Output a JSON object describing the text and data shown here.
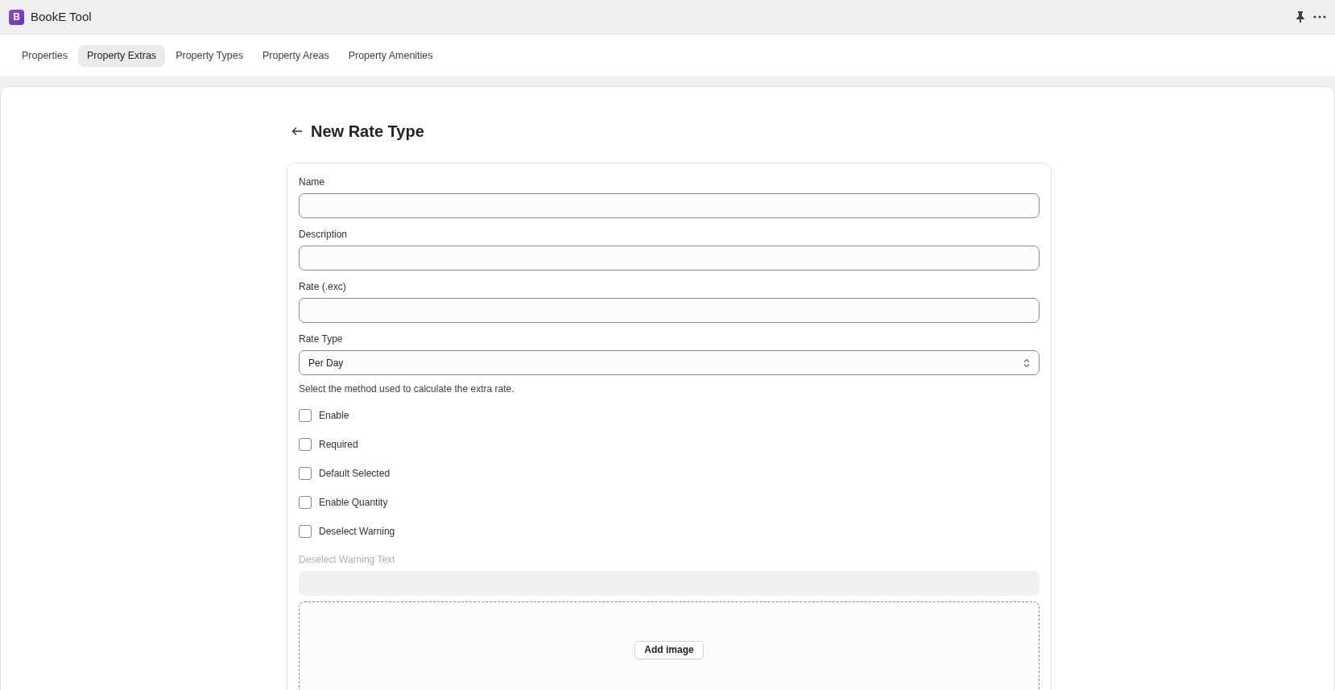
{
  "window": {
    "title": "BookE Tool",
    "logo_letter": "B"
  },
  "tabs": [
    {
      "label": "Properties",
      "selected": false
    },
    {
      "label": "Property Extras",
      "selected": true
    },
    {
      "label": "Property Types",
      "selected": false
    },
    {
      "label": "Property Areas",
      "selected": false
    },
    {
      "label": "Property Amenities",
      "selected": false
    }
  ],
  "page": {
    "title": "New Rate Type"
  },
  "form": {
    "fields": [
      {
        "kind": "text",
        "label": "Name",
        "disabled": false
      },
      {
        "kind": "text",
        "label": "Description",
        "disabled": false
      },
      {
        "kind": "text",
        "label": "Rate (.exc)",
        "disabled": false
      },
      {
        "kind": "select",
        "label": "Rate Type",
        "value": "Per Day",
        "help": "Select the method used to calculate the extra rate.",
        "disabled": false
      },
      {
        "kind": "checkbox",
        "label": "Enable",
        "checked": false
      },
      {
        "kind": "checkbox",
        "label": "Required",
        "checked": false
      },
      {
        "kind": "checkbox",
        "label": "Default Selected",
        "checked": false
      },
      {
        "kind": "checkbox",
        "label": "Enable Quantity",
        "checked": false
      },
      {
        "kind": "checkbox",
        "label": "Deselect Warning",
        "checked": false
      },
      {
        "kind": "text",
        "label": "Deselect Warning Text",
        "disabled": true
      },
      {
        "kind": "image",
        "button": "Add image"
      }
    ]
  }
}
